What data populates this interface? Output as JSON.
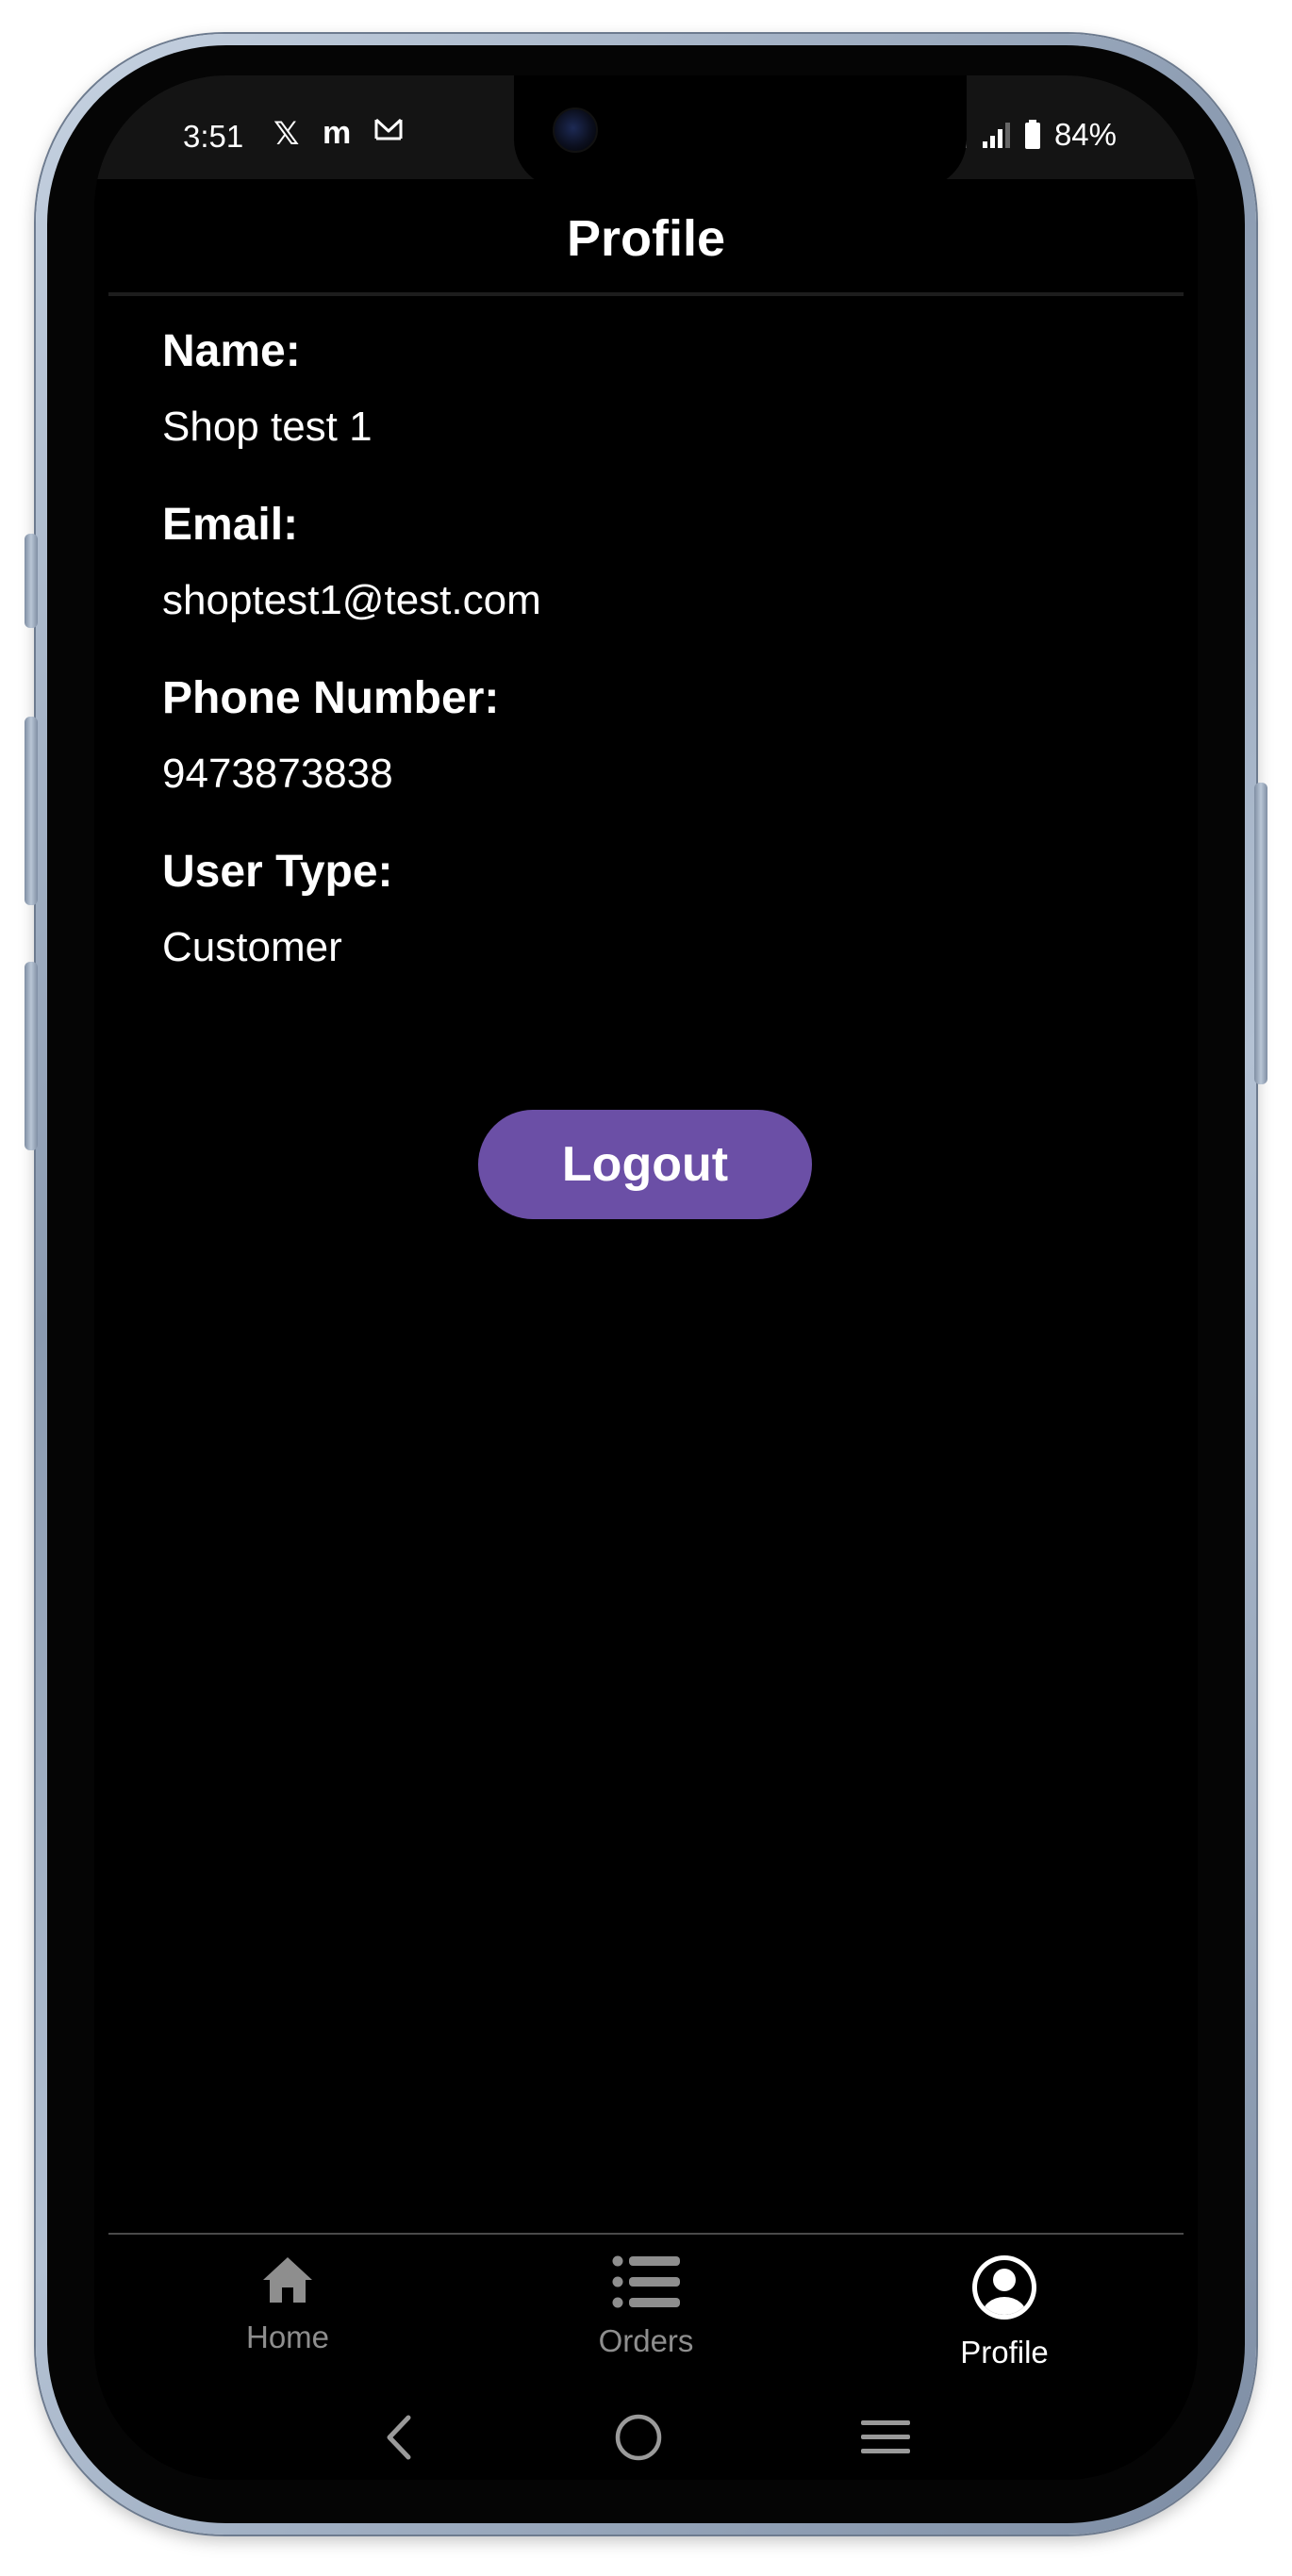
{
  "status_bar": {
    "time": "3:51",
    "app_icons": [
      "x-icon",
      "m-icon",
      "mail-icon"
    ],
    "battery_percent": "84%"
  },
  "header": {
    "title": "Profile"
  },
  "profile": {
    "name_label": "Name:",
    "name_value": "Shop test 1",
    "email_label": "Email:",
    "email_value": "shoptest1@test.com",
    "phone_label": "Phone Number:",
    "phone_value": "9473873838",
    "user_type_label": "User Type:",
    "user_type_value": "Customer"
  },
  "actions": {
    "logout_label": "Logout"
  },
  "tabs": [
    {
      "label": "Home",
      "icon": "home-icon",
      "active": false
    },
    {
      "label": "Orders",
      "icon": "list-icon",
      "active": false
    },
    {
      "label": "Profile",
      "icon": "user-circle-icon",
      "active": true
    }
  ],
  "colors": {
    "background": "#000000",
    "accent": "#6b4fa6",
    "text": "#ffffff",
    "inactive_tab": "#8e8e8e"
  }
}
